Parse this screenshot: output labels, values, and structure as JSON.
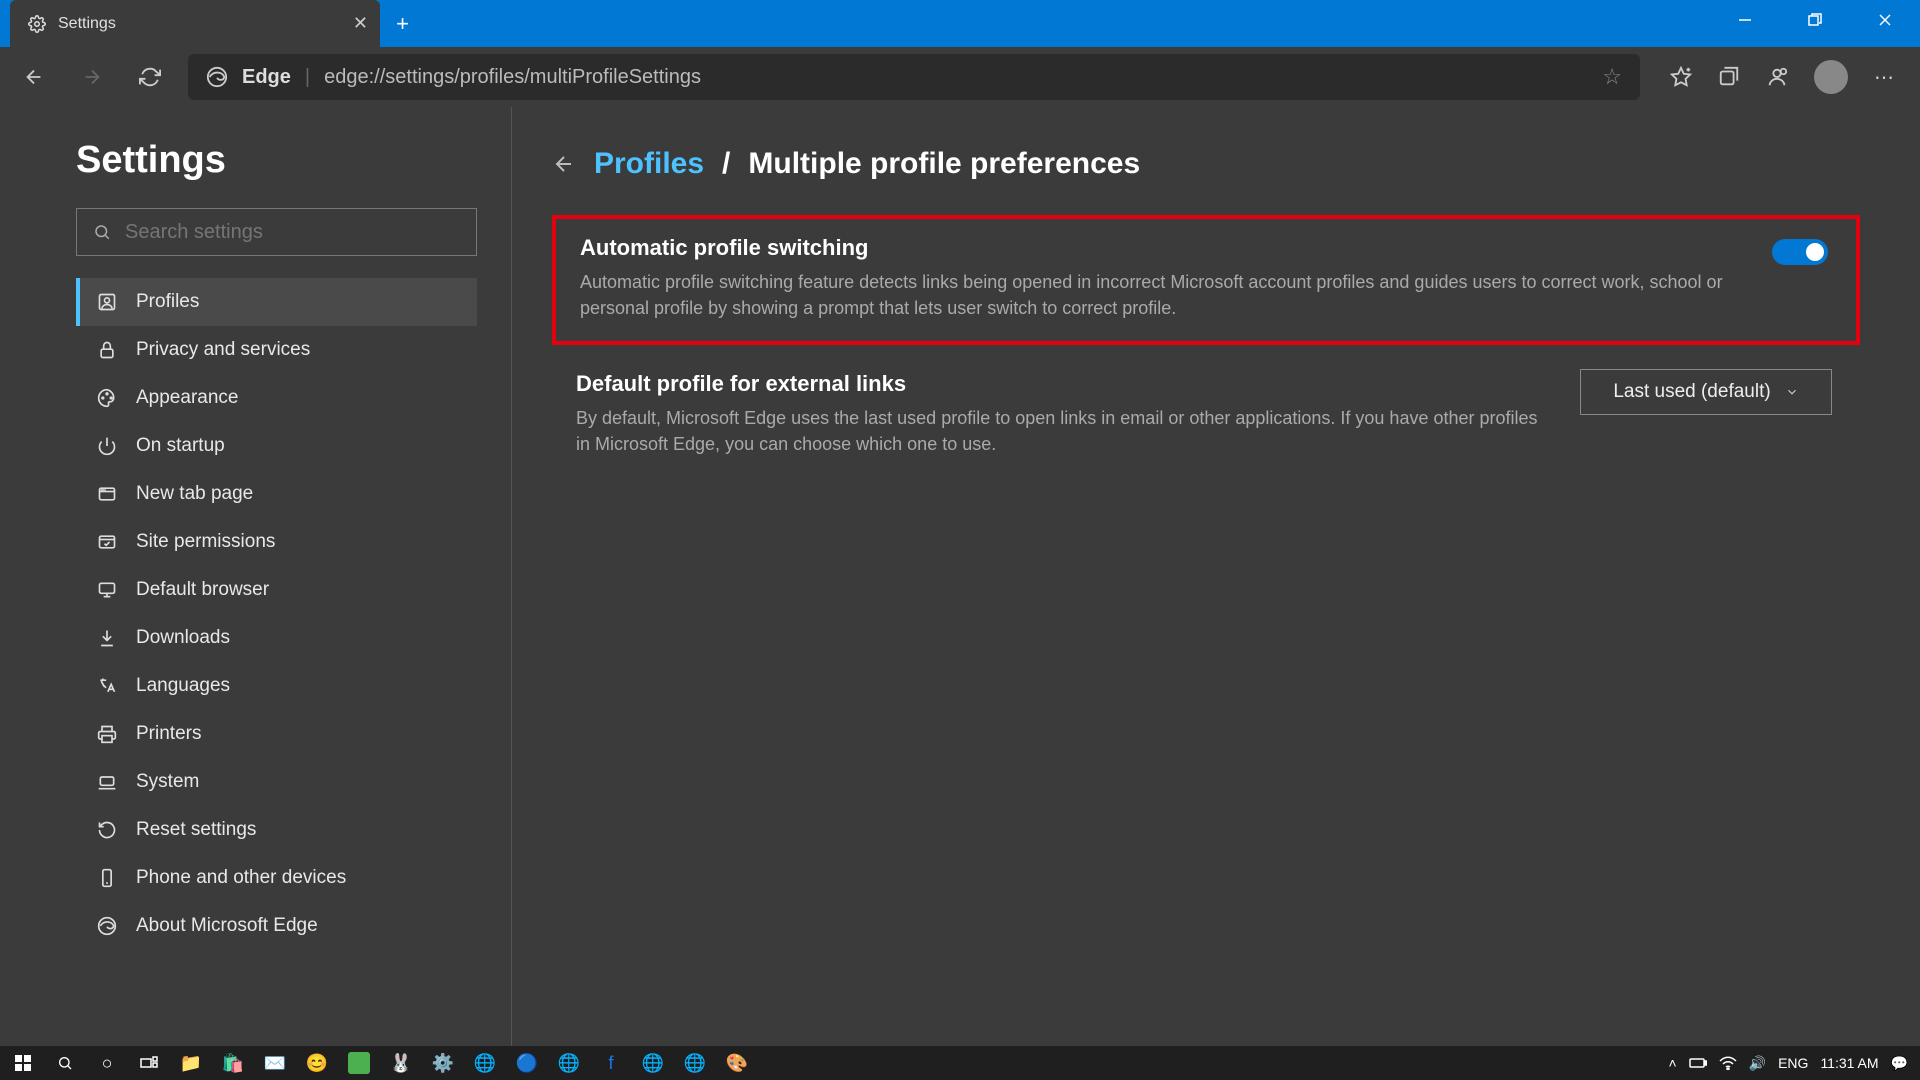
{
  "window": {
    "tab_title": "Settings"
  },
  "addressbar": {
    "brand": "Edge",
    "url": "edge://settings/profiles/multiProfileSettings"
  },
  "sidebar": {
    "title": "Settings",
    "search_placeholder": "Search settings",
    "items": [
      {
        "label": "Profiles"
      },
      {
        "label": "Privacy and services"
      },
      {
        "label": "Appearance"
      },
      {
        "label": "On startup"
      },
      {
        "label": "New tab page"
      },
      {
        "label": "Site permissions"
      },
      {
        "label": "Default browser"
      },
      {
        "label": "Downloads"
      },
      {
        "label": "Languages"
      },
      {
        "label": "Printers"
      },
      {
        "label": "System"
      },
      {
        "label": "Reset settings"
      },
      {
        "label": "Phone and other devices"
      },
      {
        "label": "About Microsoft Edge"
      }
    ]
  },
  "breadcrumb": {
    "parent": "Profiles",
    "separator": "/",
    "current": "Multiple profile preferences"
  },
  "settings": {
    "auto_switch": {
      "title": "Automatic profile switching",
      "desc": "Automatic profile switching feature detects links being opened in incorrect Microsoft account profiles and guides users to correct work, school or personal profile by showing a prompt that lets user switch to correct profile.",
      "enabled": true
    },
    "default_profile": {
      "title": "Default profile for external links",
      "desc": "By default, Microsoft Edge uses the last used profile to open links in email or other applications. If you have other profiles in Microsoft Edge, you can choose which one to use.",
      "selected": "Last used (default)"
    }
  },
  "taskbar": {
    "lang": "ENG",
    "time": "11:31 AM"
  }
}
